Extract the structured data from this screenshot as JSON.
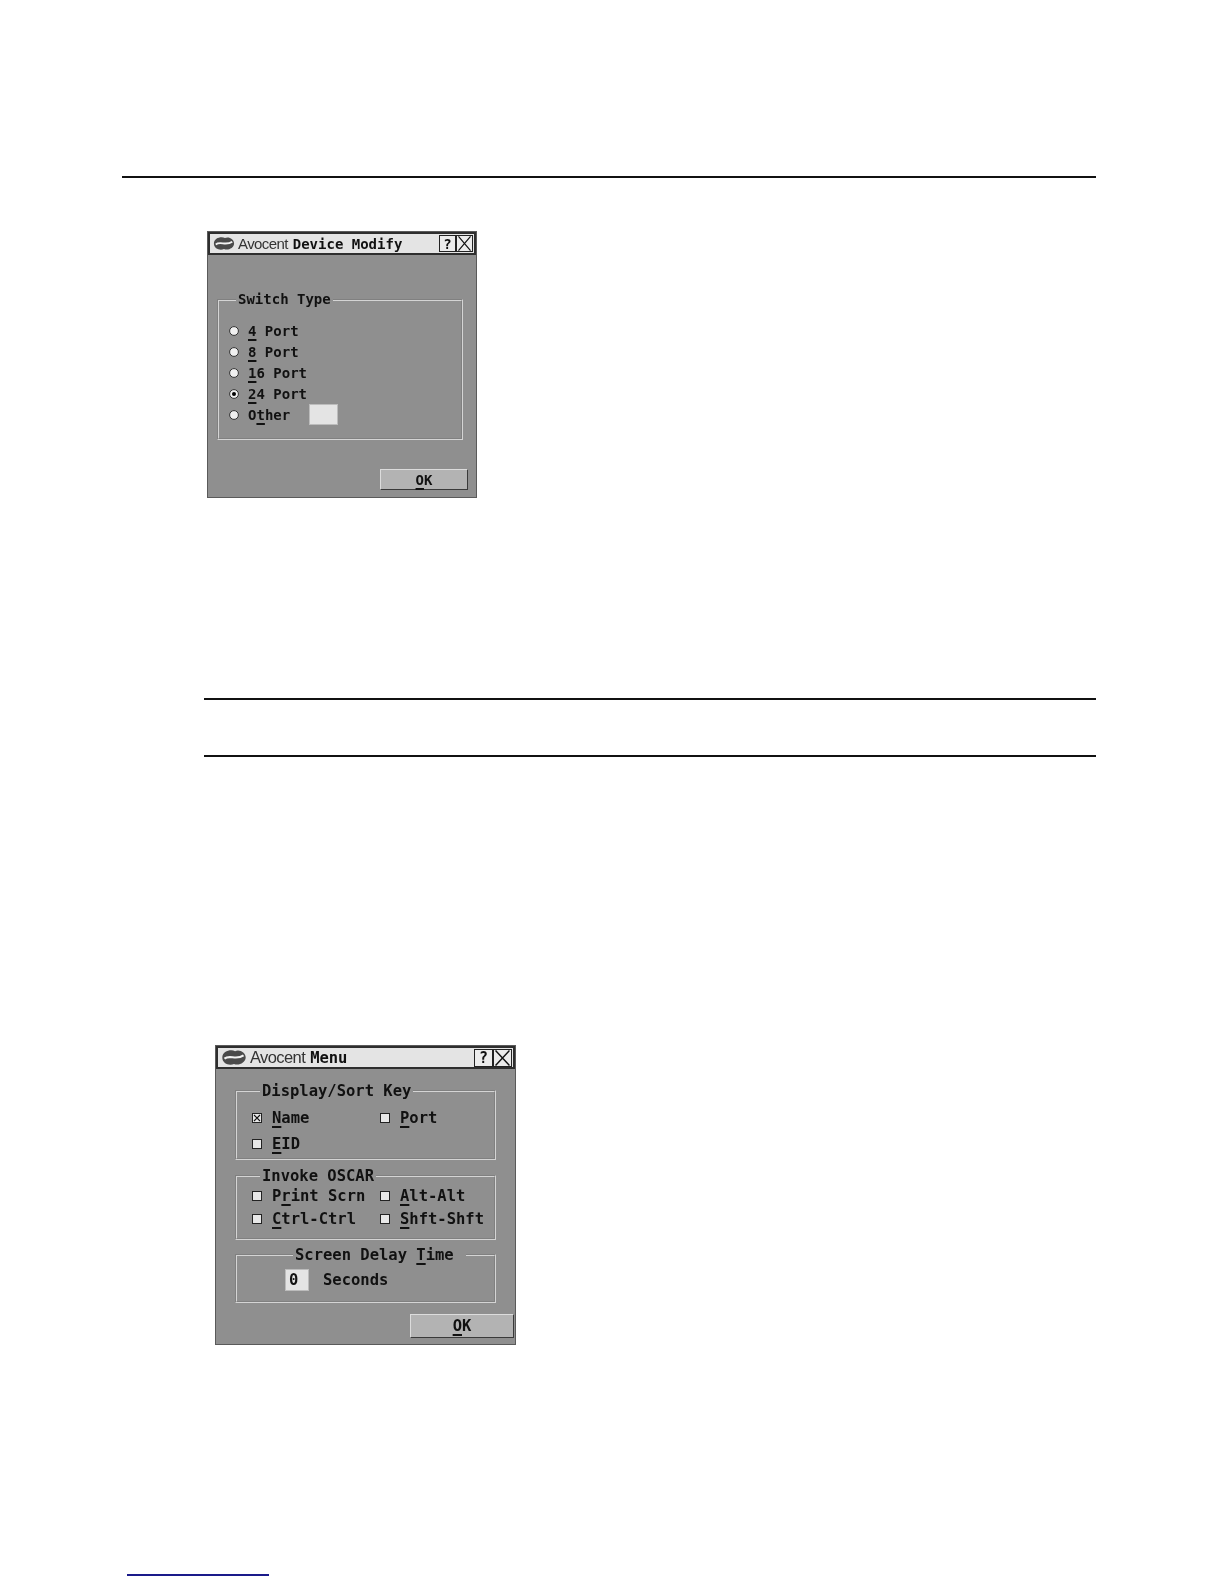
{
  "device_modify_dialog": {
    "title": {
      "brand": "Avocent",
      "text": "Device Modify"
    },
    "help_button": "?",
    "group": {
      "title": "Switch Type",
      "options": [
        {
          "kind": "radio",
          "label": {
            "key": "4",
            "post": " Port"
          },
          "selected": false
        },
        {
          "kind": "radio",
          "label": {
            "key": "8",
            "post": " Port"
          },
          "selected": false
        },
        {
          "kind": "radio",
          "label": {
            "key": "1",
            "post": "6 Port"
          },
          "selected": false
        },
        {
          "kind": "radio",
          "label": {
            "key": "2",
            "post": "4 Port"
          },
          "selected": true
        },
        {
          "kind": "radio_field",
          "label": {
            "pre": "O",
            "key": "t",
            "post": "her"
          },
          "selected": false
        }
      ]
    },
    "ok_button": {
      "key": "O",
      "post": "K"
    }
  },
  "menu_dialog": {
    "title": {
      "brand": "Avocent",
      "text": "Menu"
    },
    "help_button": "?",
    "groups": [
      {
        "kind": "checkboxes",
        "title": "Display/Sort Key",
        "items": [
          {
            "label": {
              "key": "N",
              "post": "ame"
            },
            "checked": true
          },
          {
            "label": {
              "key": "P",
              "post": "ort"
            },
            "checked": false
          },
          {
            "label": {
              "key": "E",
              "post": "ID"
            },
            "checked": false
          }
        ]
      },
      {
        "kind": "checkboxes",
        "title": "Invoke OSCAR",
        "items": [
          {
            "label": {
              "pre": "P",
              "key": "r",
              "post": "int Scrn"
            },
            "checked": false
          },
          {
            "label": {
              "key": "A",
              "post": "lt-Alt"
            },
            "checked": false
          },
          {
            "label": {
              "key": "C",
              "post": "trl-Ctrl"
            },
            "checked": false
          },
          {
            "label": {
              "key": "S",
              "post": "hft-Shft"
            },
            "checked": false
          }
        ]
      },
      {
        "kind": "delay",
        "title": {
          "pre": "Screen Delay ",
          "key": "T",
          "post": "ime"
        },
        "value": "0",
        "unit": "Seconds"
      }
    ],
    "ok_button": {
      "key": "O",
      "post": "K"
    }
  }
}
